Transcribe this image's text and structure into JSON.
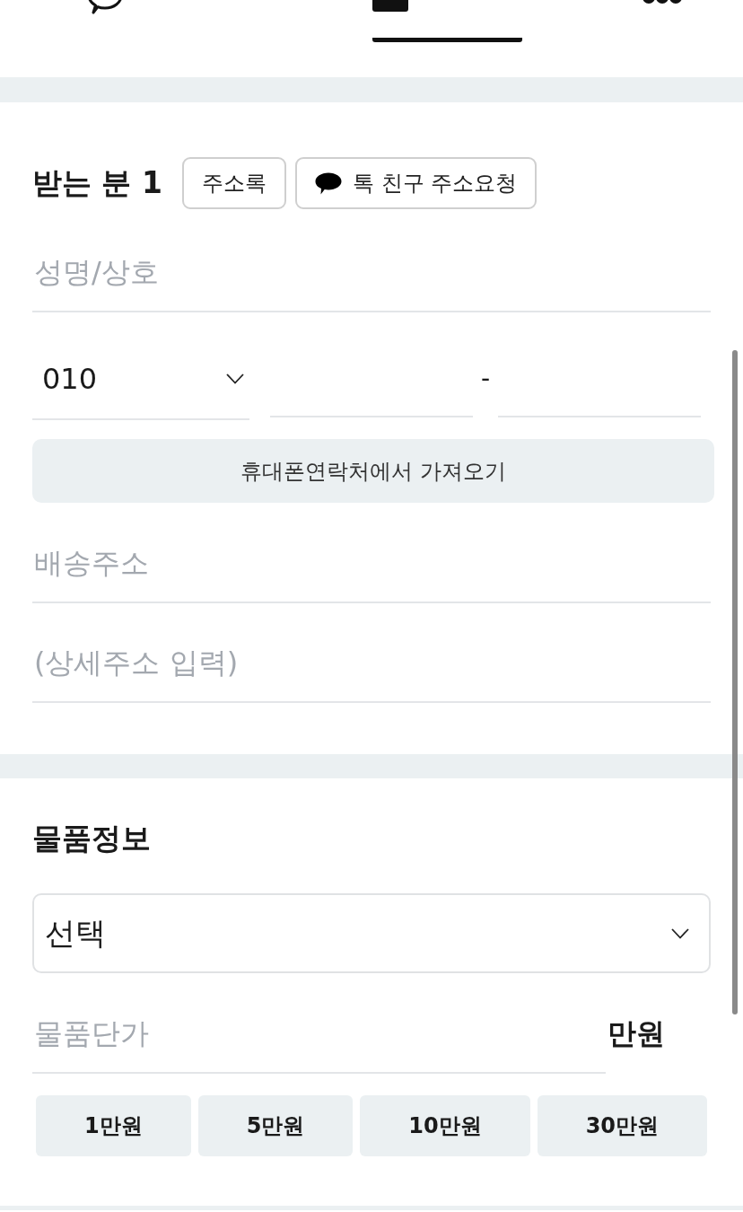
{
  "tabs": [
    {
      "kind": "chat",
      "selected": false
    },
    {
      "kind": "box",
      "selected": true
    },
    {
      "kind": "more",
      "selected": false
    }
  ],
  "recipient": {
    "title": "받는 분 1",
    "buttons": [
      {
        "label": "주소록",
        "kind": "plain"
      },
      {
        "label": "톡 친구 주소요청",
        "kind": "talk"
      }
    ],
    "name_field": {
      "placeholder": "성명/상호"
    },
    "phone": {
      "prefix": "010",
      "separator": "-"
    },
    "contacts_button": "휴대폰연락처에서 가져오기",
    "address_field": {
      "placeholder": "배송주소"
    },
    "detail_field": {
      "placeholder": "(상세주소 입력)"
    }
  },
  "item_info": {
    "title": "물품정보",
    "category_select": {
      "value": "선택"
    },
    "price_field": {
      "placeholder": "물품단가",
      "unit": "만원"
    },
    "amount_buttons": [
      "1만원",
      "5만원",
      "10만원",
      "30만원"
    ]
  }
}
